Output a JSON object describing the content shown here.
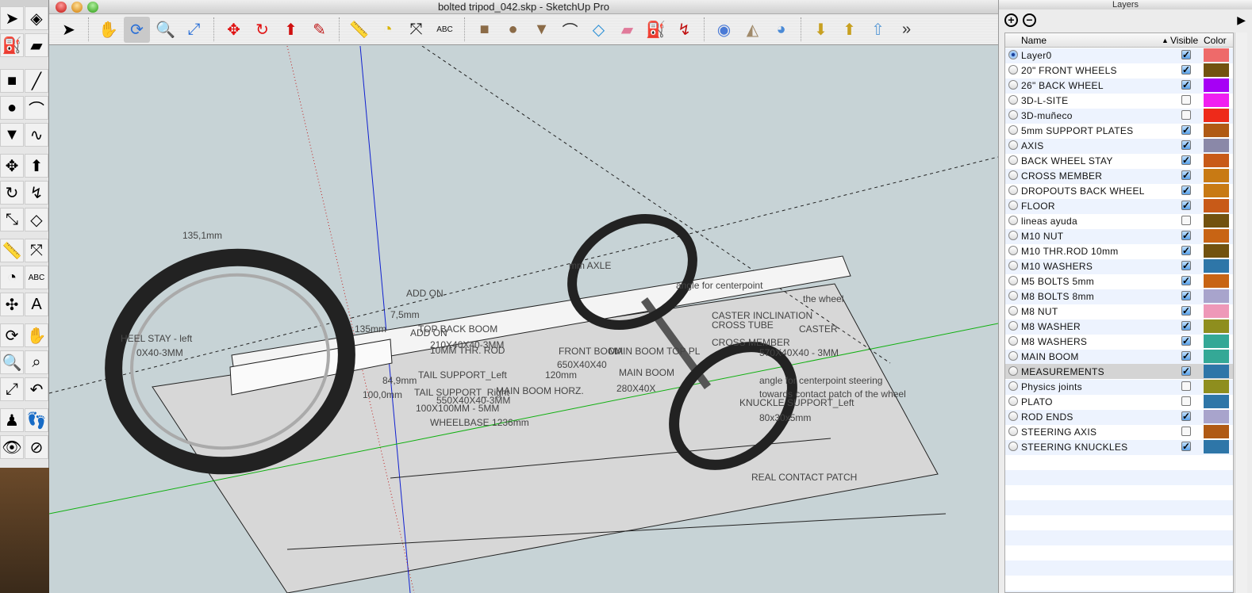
{
  "window": {
    "title": "bolted tripod_042.skp - SketchUp Pro"
  },
  "toolbar": {
    "tools": [
      {
        "name": "select",
        "glyph": "➤",
        "color": "#000"
      },
      {
        "sep": true
      },
      {
        "name": "pan",
        "glyph": "✋",
        "color": "#555"
      },
      {
        "name": "orbit",
        "glyph": "⟳",
        "color": "#2a6fd6",
        "active": true
      },
      {
        "name": "zoom",
        "glyph": "🔍",
        "color": "#333"
      },
      {
        "name": "zoom-extents",
        "glyph": "⤢",
        "color": "#2a6fd6"
      },
      {
        "sep": true
      },
      {
        "name": "move",
        "glyph": "✥",
        "color": "#e01010"
      },
      {
        "name": "rotate",
        "glyph": "↻",
        "color": "#e01010"
      },
      {
        "name": "push-pull",
        "glyph": "⬆",
        "color": "#d01010"
      },
      {
        "name": "pencil",
        "glyph": "✎",
        "color": "#c02020"
      },
      {
        "sep": true
      },
      {
        "name": "tape-measure",
        "glyph": "📏",
        "color": "#d9a400"
      },
      {
        "name": "protractor",
        "glyph": "◔",
        "color": "#d9b400"
      },
      {
        "name": "dimension",
        "glyph": "⤧",
        "color": "#111"
      },
      {
        "name": "text",
        "glyph": "ABC",
        "color": "#111"
      },
      {
        "sep": true
      },
      {
        "name": "rectangle",
        "glyph": "■",
        "color": "#8b6b47"
      },
      {
        "name": "circle",
        "glyph": "●",
        "color": "#8b6b47"
      },
      {
        "name": "polygon",
        "glyph": "▼",
        "color": "#8b6b47"
      },
      {
        "name": "arc",
        "glyph": "⌒",
        "color": "#333"
      },
      {
        "name": "offset",
        "glyph": "◇",
        "color": "#2a8fd6"
      },
      {
        "name": "eraser",
        "glyph": "▰",
        "color": "#e07a9a"
      },
      {
        "name": "paint-bucket",
        "glyph": "⛽",
        "color": "#7a6a2a"
      },
      {
        "name": "follow-me",
        "glyph": "↯",
        "color": "#c01010"
      },
      {
        "sep": true
      },
      {
        "name": "get-models",
        "glyph": "◉",
        "color": "#4a7ad6"
      },
      {
        "name": "share-model",
        "glyph": "◭",
        "color": "#a08a6a"
      },
      {
        "name": "place-model",
        "glyph": "◕",
        "color": "#4a8ad6"
      },
      {
        "sep": true
      },
      {
        "name": "get-photo-texture",
        "glyph": "⬇",
        "color": "#c8a020"
      },
      {
        "name": "export-to-earth",
        "glyph": "⬆",
        "color": "#c8a020"
      },
      {
        "name": "upload-component",
        "glyph": "⇧",
        "color": "#5a9ad6"
      },
      {
        "name": "more-tools",
        "glyph": "»",
        "color": "#333"
      }
    ]
  },
  "palette": {
    "tools": [
      "select",
      "make-component",
      "paint-bucket",
      "eraser",
      "rectangle",
      "line",
      "circle",
      "arc",
      "polygon",
      "freehand",
      "move",
      "push-pull",
      "rotate",
      "follow-me",
      "scale",
      "offset",
      "tape-measure",
      "dimension",
      "protractor",
      "text",
      "axes",
      "3d-text",
      "orbit",
      "pan",
      "zoom",
      "zoom-window",
      "zoom-extents",
      "previous",
      "position-camera",
      "walk",
      "look-around",
      "section-plane"
    ],
    "glyphs": [
      "➤",
      "◈",
      "⛽",
      "▰",
      "■",
      "╱",
      "●",
      "⌒",
      "▼",
      "∿",
      "✥",
      "⬆",
      "↻",
      "↯",
      "⤡",
      "◇",
      "📏",
      "⤧",
      "◔",
      "ABC",
      "✣",
      "A",
      "⟳",
      "✋",
      "🔍",
      "⌕",
      "⤢",
      "↶",
      "♟",
      "👣",
      "👁",
      "⊘"
    ]
  },
  "viewport": {
    "labels": [
      {
        "text": "135,1mm"
      },
      {
        "text": "ADD ON"
      },
      {
        "text": "7,5mm"
      },
      {
        "text": "135mm"
      },
      {
        "text": "TOP BACK BOOM"
      },
      {
        "text": "ADD ON"
      },
      {
        "text": "210X40X40-3MM"
      },
      {
        "text": "10MM THR. ROD"
      },
      {
        "text": "HEEL STAY - left"
      },
      {
        "text": "0X40-3MM"
      },
      {
        "text": "TAIL SUPPORT_Left"
      },
      {
        "text": "84,9mm"
      },
      {
        "text": "100,0mm"
      },
      {
        "text": "TAIL SUPPORT_Right"
      },
      {
        "text": "100X100MM - 5MM"
      },
      {
        "text": "MAIN BOOM HORZ."
      },
      {
        "text": "550X40X40-3MM"
      },
      {
        "text": "WHEELBASE 1236mm"
      },
      {
        "text": "FRONT BOOM"
      },
      {
        "text": "MAIN BOOM TOP PL"
      },
      {
        "text": "650X40X40"
      },
      {
        "text": "120mm"
      },
      {
        "text": "MAIN BOOM"
      },
      {
        "text": "280X40X"
      },
      {
        "text": "mm AXLE"
      },
      {
        "text": "angle for centerpoint"
      },
      {
        "text": "the wheel"
      },
      {
        "text": "CASTER INCLINATION"
      },
      {
        "text": "CROSS TUBE"
      },
      {
        "text": "CASTER"
      },
      {
        "text": "CROSS MEMBER"
      },
      {
        "text": "570X40X40 - 3MM"
      },
      {
        "text": "angle for centerpoint steering"
      },
      {
        "text": "towards contact patch of the wheel"
      },
      {
        "text": "KNUCKLE SUPPORT_Left"
      },
      {
        "text": "80x30x5mm"
      },
      {
        "text": "REAL CONTACT PATCH"
      }
    ]
  },
  "layers": {
    "title": "Layers",
    "columns": {
      "name": "Name",
      "visible": "Visible",
      "color": "Color"
    },
    "rows": [
      {
        "name": "Layer0",
        "visible": true,
        "color": "#ee6a6a",
        "active": true
      },
      {
        "name": "20\" FRONT WHEELS",
        "visible": true,
        "color": "#72520f"
      },
      {
        "name": "26\" BACK WHEEL",
        "visible": true,
        "color": "#a600f5"
      },
      {
        "name": "3D-L-SITE",
        "visible": false,
        "color": "#f01ef0"
      },
      {
        "name": "3D-muñeco",
        "visible": false,
        "color": "#ee2a1a"
      },
      {
        "name": "5mm SUPPORT PLATES",
        "visible": true,
        "color": "#b05a14"
      },
      {
        "name": "AXIS",
        "visible": true,
        "color": "#8a88a8"
      },
      {
        "name": "BACK WHEEL STAY",
        "visible": true,
        "color": "#c85a18"
      },
      {
        "name": "CROSS MEMBER",
        "visible": true,
        "color": "#c87a14"
      },
      {
        "name": "DROPOUTS BACK WHEEL",
        "visible": true,
        "color": "#c87a14"
      },
      {
        "name": "FLOOR",
        "visible": true,
        "color": "#c85a18"
      },
      {
        "name": "lineas ayuda",
        "visible": false,
        "color": "#72520f"
      },
      {
        "name": "M10 NUT",
        "visible": true,
        "color": "#c86414"
      },
      {
        "name": "M10 THR.ROD 10mm",
        "visible": true,
        "color": "#72520f"
      },
      {
        "name": "M10 WASHERS",
        "visible": true,
        "color": "#2e76a8"
      },
      {
        "name": "M5 BOLTS 5mm",
        "visible": true,
        "color": "#c86414"
      },
      {
        "name": "M8 BOLTS 8mm",
        "visible": true,
        "color": "#a8a4cc"
      },
      {
        "name": "M8 NUT",
        "visible": true,
        "color": "#ee98b8"
      },
      {
        "name": "M8 WASHER",
        "visible": true,
        "color": "#8e8e1e"
      },
      {
        "name": "M8 WASHERS",
        "visible": true,
        "color": "#34a896"
      },
      {
        "name": "MAIN BOOM",
        "visible": true,
        "color": "#34a896"
      },
      {
        "name": "MEASUREMENTS",
        "visible": true,
        "color": "#2e76a8",
        "selected": true
      },
      {
        "name": "Physics joints",
        "visible": false,
        "color": "#8e8e1e"
      },
      {
        "name": "PLATO",
        "visible": false,
        "color": "#2e76a8"
      },
      {
        "name": "ROD ENDS",
        "visible": true,
        "color": "#a8a4cc"
      },
      {
        "name": "STEERING AXIS",
        "visible": false,
        "color": "#b05a14"
      },
      {
        "name": "STEERING KNUCKLES",
        "visible": true,
        "color": "#2e76a8"
      }
    ]
  }
}
